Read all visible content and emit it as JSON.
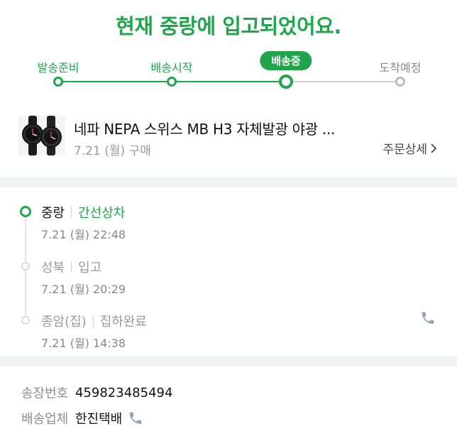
{
  "headline": "현재 중랑에 입고되었어요.",
  "steps": [
    {
      "label": "발송준비",
      "state": "done"
    },
    {
      "label": "배송시작",
      "state": "done"
    },
    {
      "label": "배송중",
      "state": "current"
    },
    {
      "label": "도착예정",
      "state": "pending"
    }
  ],
  "product": {
    "name": "네파 NEPA 스위스 MB H3 자체발광 야광 ...",
    "date": "7.21 (월) 구매",
    "order_detail_label": "주문상세",
    "thumbnail_icon": "watch-thumbnail-icon"
  },
  "timeline": [
    {
      "location": "중랑",
      "status": "간선상차",
      "time": "7.21 (월) 22:48",
      "active": true
    },
    {
      "location": "성북",
      "status": "입고",
      "time": "7.21 (월) 20:29",
      "active": false
    },
    {
      "location": "종암(집)",
      "status": "집하완료",
      "time": "7.21 (월) 14:38",
      "active": false
    }
  ],
  "info": {
    "tracking_label": "송장번호",
    "tracking_number": "459823485494",
    "carrier_label": "배송업체",
    "carrier_name": "한진택배"
  },
  "colors": {
    "accent": "#1fa64a",
    "pending": "#b4bcc4",
    "phone_icon": "#8fa4b8"
  }
}
